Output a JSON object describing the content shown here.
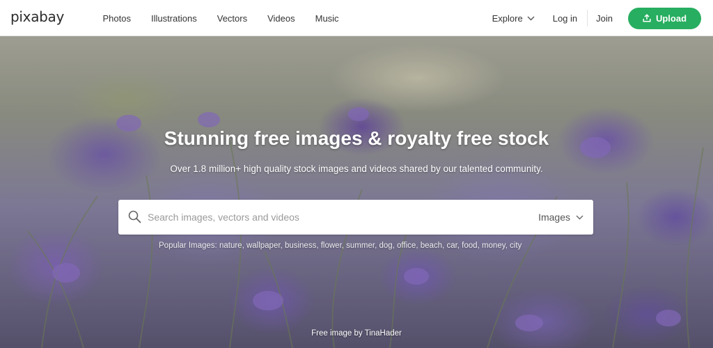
{
  "header": {
    "logo": "pixabay",
    "nav": [
      "Photos",
      "Illustrations",
      "Vectors",
      "Videos",
      "Music"
    ],
    "explore_label": "Explore",
    "login_label": "Log in",
    "join_label": "Join",
    "upload_label": "Upload",
    "accent_color": "#27ae60"
  },
  "hero": {
    "headline": "Stunning free images & royalty free stock",
    "subline": "Over 1.8 million+ high quality stock images and videos shared by our talented community.",
    "search": {
      "placeholder": "Search images, vectors and videos",
      "value": "",
      "type_selected": "Images"
    },
    "popular_label": "Popular Images:",
    "popular_tags": [
      "nature",
      "wallpaper",
      "business",
      "flower",
      "summer",
      "dog",
      "office",
      "beach",
      "car",
      "food",
      "money",
      "city"
    ],
    "credit": "Free image by TinaHader"
  },
  "icons": {
    "search": "search-icon",
    "upload": "upload-icon",
    "chevron": "chevron-down-icon"
  }
}
